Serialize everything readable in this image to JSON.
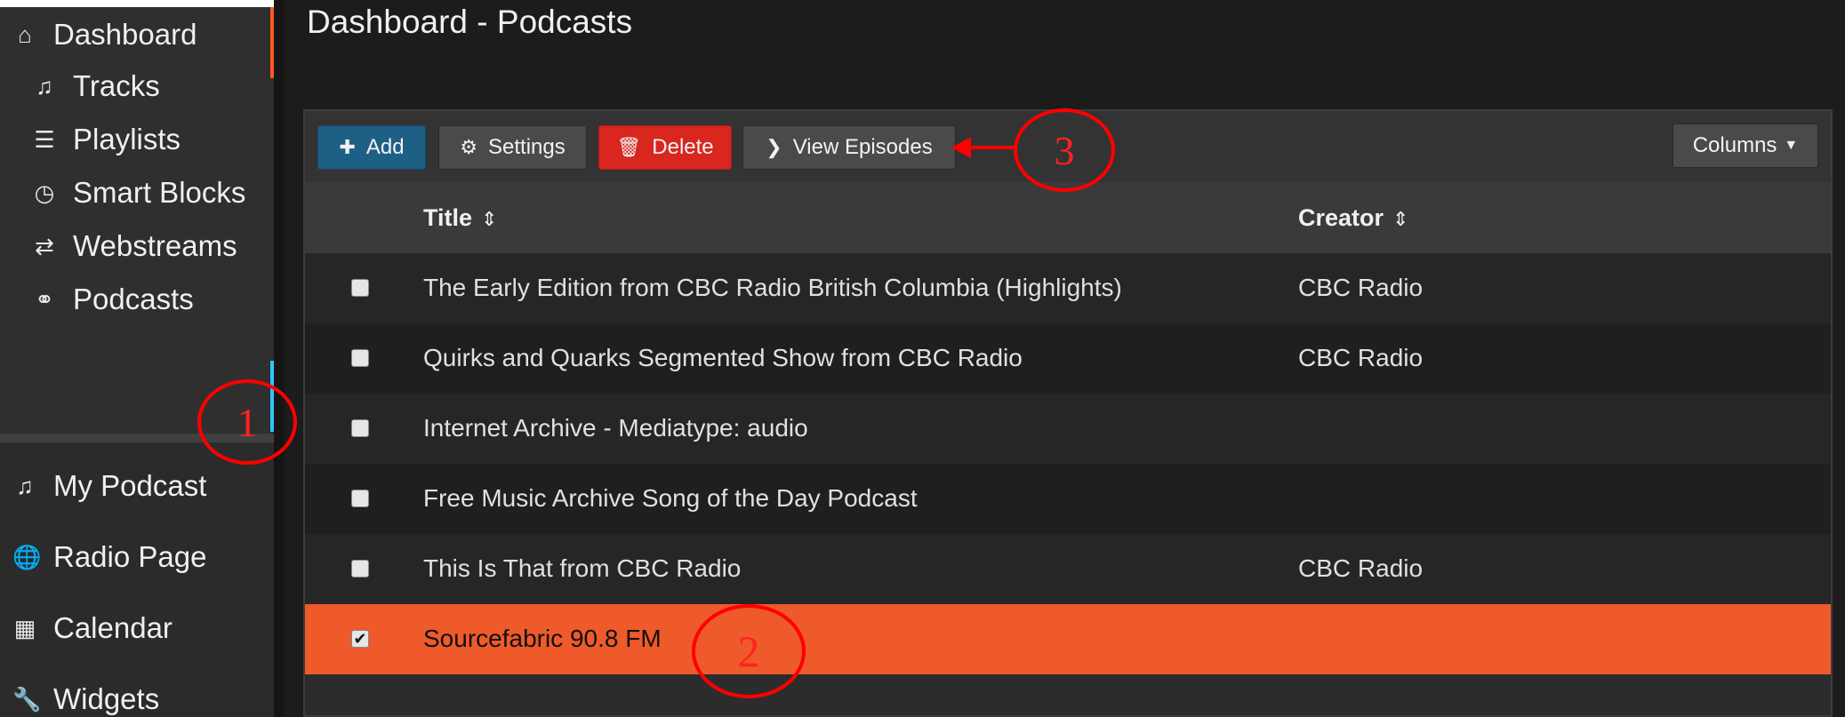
{
  "page": {
    "title": "Dashboard - Podcasts"
  },
  "sidebar": {
    "top_item": {
      "label": "Dashboard",
      "icon": "home-icon"
    },
    "sub_items": [
      {
        "label": "Tracks",
        "icon": "music-note-icon"
      },
      {
        "label": "Playlists",
        "icon": "list-icon"
      },
      {
        "label": "Smart Blocks",
        "icon": "clock-icon"
      },
      {
        "label": "Webstreams",
        "icon": "shuffle-icon"
      },
      {
        "label": "Podcasts",
        "icon": "headphones-icon"
      }
    ],
    "main_items": [
      {
        "label": "My Podcast",
        "icon": "music-note-icon"
      },
      {
        "label": "Radio Page",
        "icon": "globe-icon"
      },
      {
        "label": "Calendar",
        "icon": "calendar-icon"
      },
      {
        "label": "Widgets",
        "icon": "wrench-icon"
      }
    ]
  },
  "toolbar": {
    "add": "Add",
    "settings": "Settings",
    "delete": "Delete",
    "view_episodes": "View Episodes",
    "columns": "Columns"
  },
  "table": {
    "headers": {
      "title": "Title",
      "creator": "Creator"
    },
    "rows": [
      {
        "title": "The Early Edition from CBC Radio British Columbia (Highlights)",
        "creator": "CBC Radio",
        "checked": false
      },
      {
        "title": "Quirks and Quarks Segmented Show from CBC Radio",
        "creator": "CBC Radio",
        "checked": false
      },
      {
        "title": "Internet Archive - Mediatype: audio",
        "creator": "",
        "checked": false
      },
      {
        "title": "Free Music Archive Song of the Day Podcast",
        "creator": "",
        "checked": false
      },
      {
        "title": "This Is That from CBC Radio",
        "creator": "CBC Radio",
        "checked": false
      },
      {
        "title": "Sourcefabric 90.8 FM",
        "creator": "",
        "checked": true
      }
    ]
  },
  "annotations": {
    "one": "1",
    "two": "2",
    "three": "3"
  },
  "colors": {
    "accent": "#ee5a2a",
    "active_dashboard": "#ff5a1f",
    "active_podcasts": "#33c3ff",
    "delete": "#d9261f",
    "add": "#1e5f86",
    "annotation": "#ff0000"
  }
}
